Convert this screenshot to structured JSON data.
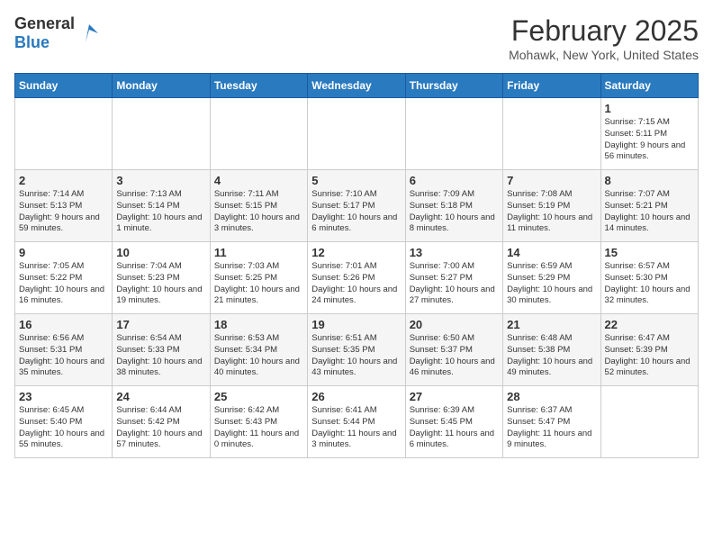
{
  "header": {
    "logo_general": "General",
    "logo_blue": "Blue",
    "title": "February 2025",
    "subtitle": "Mohawk, New York, United States"
  },
  "days_of_week": [
    "Sunday",
    "Monday",
    "Tuesday",
    "Wednesday",
    "Thursday",
    "Friday",
    "Saturday"
  ],
  "weeks": [
    [
      {
        "day": "",
        "info": ""
      },
      {
        "day": "",
        "info": ""
      },
      {
        "day": "",
        "info": ""
      },
      {
        "day": "",
        "info": ""
      },
      {
        "day": "",
        "info": ""
      },
      {
        "day": "",
        "info": ""
      },
      {
        "day": "1",
        "info": "Sunrise: 7:15 AM\nSunset: 5:11 PM\nDaylight: 9 hours and 56 minutes."
      }
    ],
    [
      {
        "day": "2",
        "info": "Sunrise: 7:14 AM\nSunset: 5:13 PM\nDaylight: 9 hours and 59 minutes."
      },
      {
        "day": "3",
        "info": "Sunrise: 7:13 AM\nSunset: 5:14 PM\nDaylight: 10 hours and 1 minute."
      },
      {
        "day": "4",
        "info": "Sunrise: 7:11 AM\nSunset: 5:15 PM\nDaylight: 10 hours and 3 minutes."
      },
      {
        "day": "5",
        "info": "Sunrise: 7:10 AM\nSunset: 5:17 PM\nDaylight: 10 hours and 6 minutes."
      },
      {
        "day": "6",
        "info": "Sunrise: 7:09 AM\nSunset: 5:18 PM\nDaylight: 10 hours and 8 minutes."
      },
      {
        "day": "7",
        "info": "Sunrise: 7:08 AM\nSunset: 5:19 PM\nDaylight: 10 hours and 11 minutes."
      },
      {
        "day": "8",
        "info": "Sunrise: 7:07 AM\nSunset: 5:21 PM\nDaylight: 10 hours and 14 minutes."
      }
    ],
    [
      {
        "day": "9",
        "info": "Sunrise: 7:05 AM\nSunset: 5:22 PM\nDaylight: 10 hours and 16 minutes."
      },
      {
        "day": "10",
        "info": "Sunrise: 7:04 AM\nSunset: 5:23 PM\nDaylight: 10 hours and 19 minutes."
      },
      {
        "day": "11",
        "info": "Sunrise: 7:03 AM\nSunset: 5:25 PM\nDaylight: 10 hours and 21 minutes."
      },
      {
        "day": "12",
        "info": "Sunrise: 7:01 AM\nSunset: 5:26 PM\nDaylight: 10 hours and 24 minutes."
      },
      {
        "day": "13",
        "info": "Sunrise: 7:00 AM\nSunset: 5:27 PM\nDaylight: 10 hours and 27 minutes."
      },
      {
        "day": "14",
        "info": "Sunrise: 6:59 AM\nSunset: 5:29 PM\nDaylight: 10 hours and 30 minutes."
      },
      {
        "day": "15",
        "info": "Sunrise: 6:57 AM\nSunset: 5:30 PM\nDaylight: 10 hours and 32 minutes."
      }
    ],
    [
      {
        "day": "16",
        "info": "Sunrise: 6:56 AM\nSunset: 5:31 PM\nDaylight: 10 hours and 35 minutes."
      },
      {
        "day": "17",
        "info": "Sunrise: 6:54 AM\nSunset: 5:33 PM\nDaylight: 10 hours and 38 minutes."
      },
      {
        "day": "18",
        "info": "Sunrise: 6:53 AM\nSunset: 5:34 PM\nDaylight: 10 hours and 40 minutes."
      },
      {
        "day": "19",
        "info": "Sunrise: 6:51 AM\nSunset: 5:35 PM\nDaylight: 10 hours and 43 minutes."
      },
      {
        "day": "20",
        "info": "Sunrise: 6:50 AM\nSunset: 5:37 PM\nDaylight: 10 hours and 46 minutes."
      },
      {
        "day": "21",
        "info": "Sunrise: 6:48 AM\nSunset: 5:38 PM\nDaylight: 10 hours and 49 minutes."
      },
      {
        "day": "22",
        "info": "Sunrise: 6:47 AM\nSunset: 5:39 PM\nDaylight: 10 hours and 52 minutes."
      }
    ],
    [
      {
        "day": "23",
        "info": "Sunrise: 6:45 AM\nSunset: 5:40 PM\nDaylight: 10 hours and 55 minutes."
      },
      {
        "day": "24",
        "info": "Sunrise: 6:44 AM\nSunset: 5:42 PM\nDaylight: 10 hours and 57 minutes."
      },
      {
        "day": "25",
        "info": "Sunrise: 6:42 AM\nSunset: 5:43 PM\nDaylight: 11 hours and 0 minutes."
      },
      {
        "day": "26",
        "info": "Sunrise: 6:41 AM\nSunset: 5:44 PM\nDaylight: 11 hours and 3 minutes."
      },
      {
        "day": "27",
        "info": "Sunrise: 6:39 AM\nSunset: 5:45 PM\nDaylight: 11 hours and 6 minutes."
      },
      {
        "day": "28",
        "info": "Sunrise: 6:37 AM\nSunset: 5:47 PM\nDaylight: 11 hours and 9 minutes."
      },
      {
        "day": "",
        "info": ""
      }
    ]
  ]
}
